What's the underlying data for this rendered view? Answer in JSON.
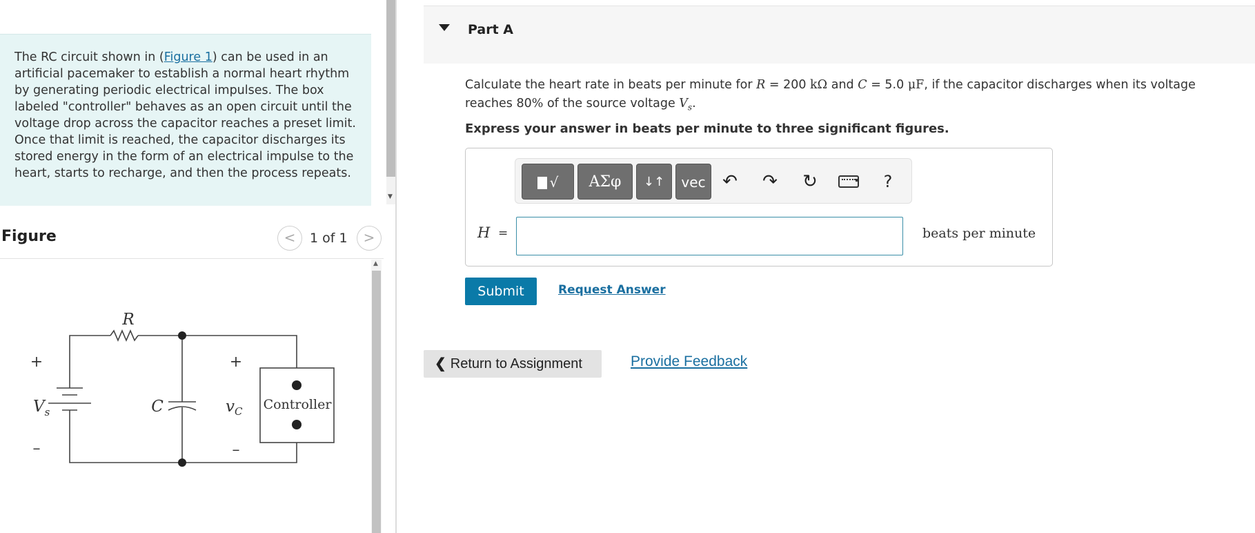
{
  "intro": {
    "text_before": "The RC circuit shown in (",
    "figure_link": "Figure 1",
    "text_after": ") can be used in an artificial pacemaker to establish a normal heart rhythm by generating periodic electrical impulses. The box labeled \"controller\" behaves as an open circuit until the voltage drop across the capacitor reaches a preset limit. Once that limit is reached, the capacitor discharges its stored energy in the form of an electrical impulse to the heart, starts to recharge, and then the process repeats."
  },
  "figure": {
    "title": "Figure",
    "prev_symbol": "<",
    "next_symbol": ">",
    "counter": "1 of 1",
    "labels": {
      "resistor": "R",
      "capacitor": "C",
      "source": "V",
      "source_sub": "s",
      "voltage": "v",
      "voltage_sub": "C",
      "plus": "+",
      "minus": "–",
      "controller": "Controller"
    }
  },
  "part": {
    "title": "Part A",
    "question": {
      "q1": "Calculate the heart rate in beats per minute for ",
      "R_sym": "R",
      "eq1": " = 200 ",
      "R_unit": "kΩ",
      "and": " and ",
      "C_sym": "C",
      "eq2": " = 5.0 ",
      "C_unit": "μF",
      "q2": ", if the capacitor discharges when its voltage reaches 80",
      "pct": "%",
      "q3": " of the source voltage ",
      "V_sym": "V",
      "V_sub": "s",
      "end": "."
    },
    "instruction": "Express your answer in beats per minute to three significant figures.",
    "toolbar": {
      "templates_label": "√",
      "symbols_label": "ΑΣφ",
      "arrows_label": "↓↑",
      "vector_label": "vec",
      "undo": "↶",
      "redo": "↷",
      "reset": "↻",
      "help": "?"
    },
    "answer": {
      "variable": "H",
      "equals": "=",
      "value": "",
      "unit": "beats per minute"
    },
    "submit_label": "Submit",
    "request_answer_label": "Request Answer"
  },
  "footer": {
    "return_label": "Return to Assignment",
    "feedback_label": "Provide Feedback"
  }
}
